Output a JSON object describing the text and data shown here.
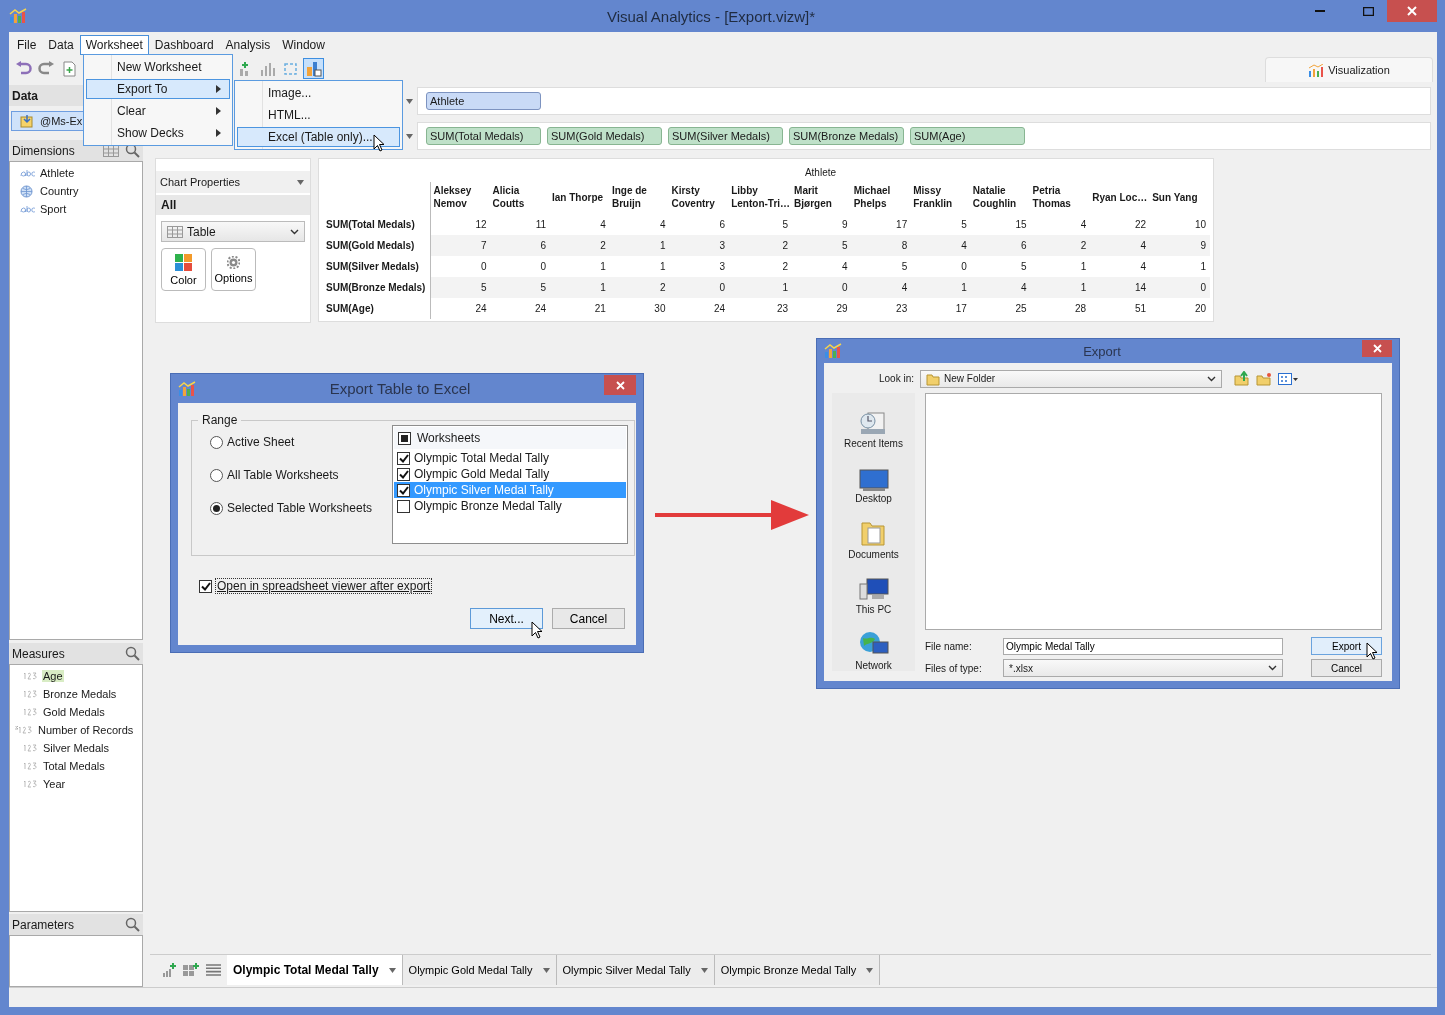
{
  "window": {
    "title": "Visual Analytics - [Export.vizw]*"
  },
  "menubar": [
    {
      "label": "File",
      "selected": false
    },
    {
      "label": "Data",
      "selected": false
    },
    {
      "label": "Worksheet",
      "selected": true
    },
    {
      "label": "Dashboard",
      "selected": false
    },
    {
      "label": "Analysis",
      "selected": false
    },
    {
      "label": "Window",
      "selected": false
    }
  ],
  "toolbar": {
    "left": [
      {
        "kind": "undo",
        "selected": false
      },
      {
        "kind": "redo",
        "selected": false
      },
      {
        "kind": "new-sheet",
        "selected": false
      }
    ],
    "right": [
      {
        "kind": "add-chart",
        "selected": false
      },
      {
        "kind": "bars",
        "selected": false
      },
      {
        "kind": "lasso",
        "selected": false
      },
      {
        "kind": "chart-view",
        "selected": true
      }
    ],
    "tab": "Visualization"
  },
  "worksheet_menu": {
    "items": [
      {
        "label": "New Worksheet",
        "submenu": false,
        "selected": false
      },
      {
        "label": "Export To",
        "submenu": true,
        "selected": true
      },
      {
        "label": "Clear",
        "submenu": true,
        "selected": false
      },
      {
        "label": "Show Decks",
        "submenu": true,
        "selected": false
      }
    ]
  },
  "export_submenu": {
    "items": [
      {
        "label": "Image...",
        "selected": false
      },
      {
        "label": "HTML...",
        "selected": false
      },
      {
        "label": "Excel (Table only)...",
        "selected": true
      }
    ]
  },
  "data_panel": {
    "title": "Data",
    "source": "@Ms-Ex"
  },
  "dimensions": {
    "title": "Dimensions",
    "items": [
      {
        "label": "Athlete",
        "kind": "text"
      },
      {
        "label": "Country",
        "kind": "geo"
      },
      {
        "label": "Sport",
        "kind": "text"
      }
    ]
  },
  "measures": {
    "title": "Measures",
    "items": [
      {
        "label": "Age",
        "kind": "number",
        "selected": true
      },
      {
        "label": "Bronze Medals",
        "kind": "number",
        "selected": false
      },
      {
        "label": "Gold Medals",
        "kind": "number",
        "selected": false
      },
      {
        "label": "Number of Records",
        "kind": "calculated",
        "selected": false
      },
      {
        "label": "Silver Medals",
        "kind": "number",
        "selected": false
      },
      {
        "label": "Total Medals",
        "kind": "number",
        "selected": false
      },
      {
        "label": "Year",
        "kind": "number",
        "selected": false
      }
    ]
  },
  "parameters": {
    "title": "Parameters"
  },
  "shelves": {
    "columns": [
      "Athlete"
    ],
    "rows": [
      "SUM(Total Medals)",
      "SUM(Gold Medals)",
      "SUM(Silver Medals)",
      "SUM(Bronze Medals)",
      "SUM(Age)"
    ]
  },
  "chart_properties": {
    "title": "Chart Properties",
    "section": "All",
    "chart_type": "Table",
    "buttons": [
      {
        "label": "Color",
        "kind": "color"
      },
      {
        "label": "Options",
        "kind": "options"
      }
    ]
  },
  "table": {
    "header": "Athlete",
    "columns": [
      "Aleksey\nNemov",
      "Alicia\nCoutts",
      "Ian Thorpe",
      "Inge de\nBruijn",
      "Kirsty\nCoventry",
      "Libby\nLenton-Tri…",
      "Marit\nBjørgen",
      "Michael\nPhelps",
      "Missy\nFranklin",
      "Natalie\nCoughlin",
      "Petria\nThomas",
      "Ryan Loc…",
      "Sun Yang"
    ],
    "rows": [
      {
        "label": "SUM(Total Medals)",
        "values": [
          "12",
          "11",
          "4",
          "4",
          "6",
          "5",
          "9",
          "17",
          "5",
          "15",
          "4",
          "22",
          "10"
        ]
      },
      {
        "label": "SUM(Gold Medals)",
        "values": [
          "7",
          "6",
          "2",
          "1",
          "3",
          "2",
          "5",
          "8",
          "4",
          "6",
          "2",
          "4",
          "9"
        ]
      },
      {
        "label": "SUM(Silver Medals)",
        "values": [
          "0",
          "0",
          "1",
          "1",
          "3",
          "2",
          "4",
          "5",
          "0",
          "5",
          "1",
          "4",
          "1"
        ]
      },
      {
        "label": "SUM(Bronze Medals)",
        "values": [
          "5",
          "5",
          "1",
          "2",
          "0",
          "1",
          "0",
          "4",
          "1",
          "4",
          "1",
          "14",
          "0"
        ]
      },
      {
        "label": "SUM(Age)",
        "values": [
          "24",
          "24",
          "21",
          "30",
          "24",
          "23",
          "29",
          "23",
          "17",
          "25",
          "28",
          "51",
          "20"
        ]
      }
    ]
  },
  "sheet_tabs": [
    {
      "label": "Olympic Total Medal Tally",
      "selected": true
    },
    {
      "label": "Olympic Gold Medal Tally",
      "selected": false
    },
    {
      "label": "Olympic Silver Medal Tally",
      "selected": false
    },
    {
      "label": "Olympic Bronze Medal Tally",
      "selected": false
    }
  ],
  "export_table_dialog": {
    "title": "Export Table to Excel",
    "group": "Range",
    "options": [
      {
        "label": "Active Sheet",
        "selected": false
      },
      {
        "label": "All Table Worksheets",
        "selected": false
      },
      {
        "label": "Selected Table Worksheets",
        "selected": true
      }
    ],
    "worksheets": {
      "header": "Worksheets",
      "mixed": true,
      "items": [
        {
          "label": "Olympic Total Medal Tally",
          "checked": true,
          "selected": false
        },
        {
          "label": "Olympic Gold Medal Tally",
          "checked": true,
          "selected": false
        },
        {
          "label": "Olympic Silver Medal Tally",
          "checked": true,
          "selected": true
        },
        {
          "label": "Olympic Bronze Medal Tally",
          "checked": false,
          "selected": false
        }
      ]
    },
    "open_after": {
      "label": "Open in spreadsheet viewer after export",
      "checked": true
    },
    "buttons": [
      "Next...",
      "Cancel"
    ]
  },
  "export_dialog": {
    "title": "Export",
    "look_in_label": "Look in:",
    "look_in": "New Folder",
    "places": [
      {
        "label": "Recent Items",
        "kind": "recent"
      },
      {
        "label": "Desktop",
        "kind": "desktop"
      },
      {
        "label": "Documents",
        "kind": "documents"
      },
      {
        "label": "This PC",
        "kind": "pc"
      },
      {
        "label": "Network",
        "kind": "network"
      }
    ],
    "file_name_label": "File name:",
    "file_name": "Olympic Medal Tally",
    "file_type_label": "Files of type:",
    "file_type": "*.xlsx",
    "buttons": [
      "Export",
      "Cancel"
    ]
  }
}
